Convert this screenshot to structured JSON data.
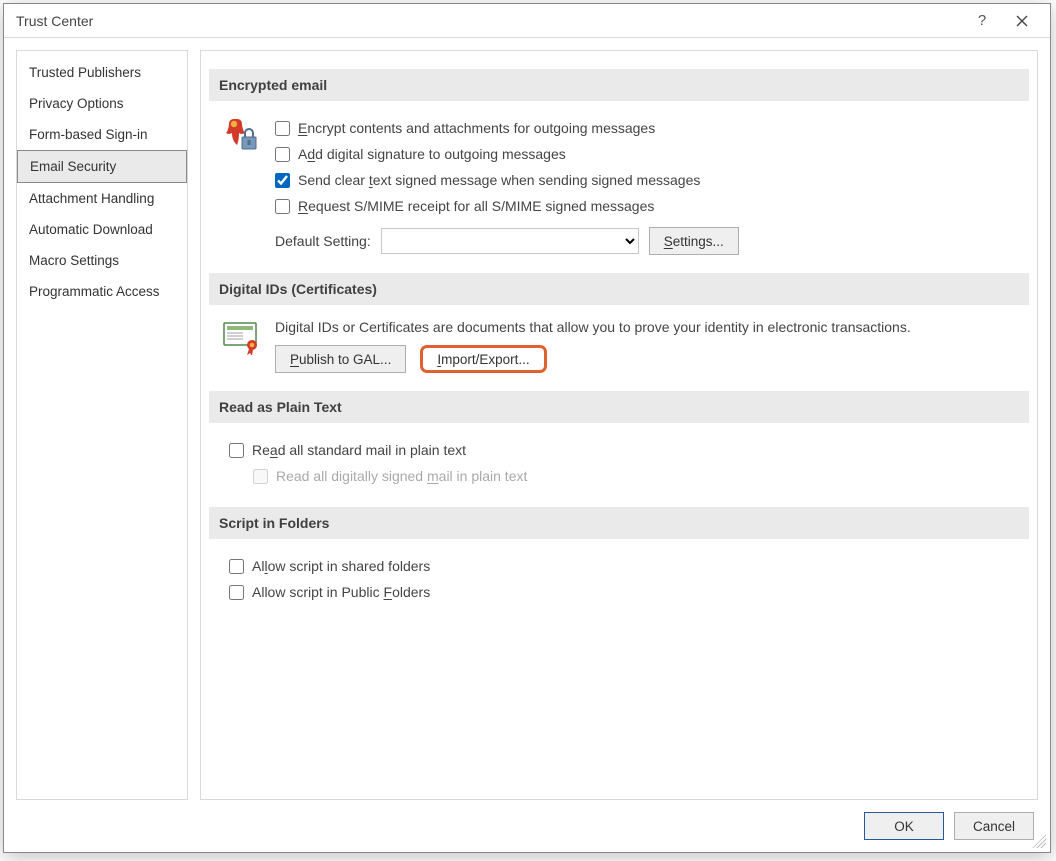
{
  "window": {
    "title": "Trust Center"
  },
  "nav": {
    "items": [
      {
        "label": "Trusted Publishers"
      },
      {
        "label": "Privacy Options"
      },
      {
        "label": "Form-based Sign-in"
      },
      {
        "label": "Email Security",
        "selected": true
      },
      {
        "label": "Attachment Handling"
      },
      {
        "label": "Automatic Download"
      },
      {
        "label": "Macro Settings"
      },
      {
        "label": "Programmatic Access"
      }
    ]
  },
  "sections": {
    "encrypted": {
      "header": "Encrypted email",
      "opt_encrypt": "Encrypt contents and attachments for outgoing messages",
      "opt_sign": "Add digital signature to outgoing messages",
      "opt_cleartext": "Send clear text signed message when sending signed messages",
      "opt_receipt": "Request S/MIME receipt for all S/MIME signed messages",
      "default_label": "Default Setting:",
      "settings_btn": "Settings..."
    },
    "digitalids": {
      "header": "Digital IDs (Certificates)",
      "desc": "Digital IDs or Certificates are documents that allow you to prove your identity in electronic transactions.",
      "publish_btn": "Publish to GAL...",
      "import_btn": "Import/Export..."
    },
    "plaintext": {
      "header": "Read as Plain Text",
      "opt_plain": "Read all standard mail in plain text",
      "opt_plain_signed": "Read all digitally signed mail in plain text"
    },
    "script": {
      "header": "Script in Folders",
      "opt_shared": "Allow script in shared folders",
      "opt_public": "Allow script in Public Folders"
    }
  },
  "footer": {
    "ok": "OK",
    "cancel": "Cancel"
  }
}
